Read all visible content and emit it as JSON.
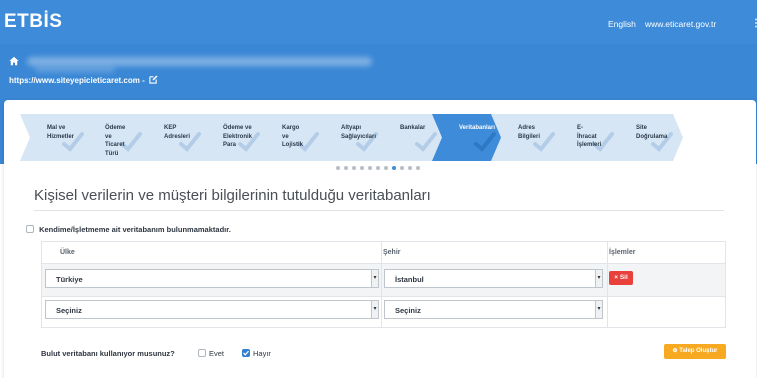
{
  "header": {
    "logo": "ETBİS",
    "language_link": "English",
    "site_link": "www.eticaret.gov.tr",
    "menu_glyph": "⋮",
    "site_url": "https://www.siteyepicieticaret.com -"
  },
  "wizard": {
    "steps": [
      {
        "label": "Mal ve\nHizmetler",
        "state": "done"
      },
      {
        "label": "Ödeme ve\nTicaret Türü",
        "state": "done"
      },
      {
        "label": "KEP\nAdresleri",
        "state": "done"
      },
      {
        "label": "Ödeme ve\nElektronik\nPara",
        "state": "done"
      },
      {
        "label": "Kargo ve\nLojistik",
        "state": "done"
      },
      {
        "label": "Altyapı\nSağlayıcıları",
        "state": "done"
      },
      {
        "label": "Bankalar",
        "state": "done"
      },
      {
        "label": "Veritabanları",
        "state": "active"
      },
      {
        "label": "Adres\nBilgileri",
        "state": "done"
      },
      {
        "label": "E-İhracat\nİşlemleri",
        "state": "done"
      },
      {
        "label": "Site\nDoğrulama",
        "state": "done"
      }
    ],
    "pager": {
      "count": 11,
      "active_index": 7
    }
  },
  "section": {
    "title": "Kişisel verilerin ve müşteri bilgilerinin tutulduğu veritabanları",
    "no_database_label": "Kendime/İşletmeme ait veritabanım bulunmamaktadır.",
    "no_database_checked": false
  },
  "table": {
    "headers": [
      "Ülke",
      "Şehir",
      "İşlemler"
    ],
    "rows": [
      {
        "country": "Türkiye",
        "city": "İstanbul",
        "action": "× Sil"
      },
      {
        "country": "Seçiniz",
        "city": "Seçiniz",
        "action": ""
      }
    ]
  },
  "cloud": {
    "question": "Bulut veritabanı kullanıyor musunuz?",
    "option_yes": "Evet",
    "option_no": "Hayır",
    "selected": "Hayır"
  },
  "actions": {
    "create_request": "⊕ Talep Oluştur"
  },
  "colors": {
    "brand": "#3d8bd9",
    "delete": "#e8413c",
    "warning": "#f7a921"
  }
}
